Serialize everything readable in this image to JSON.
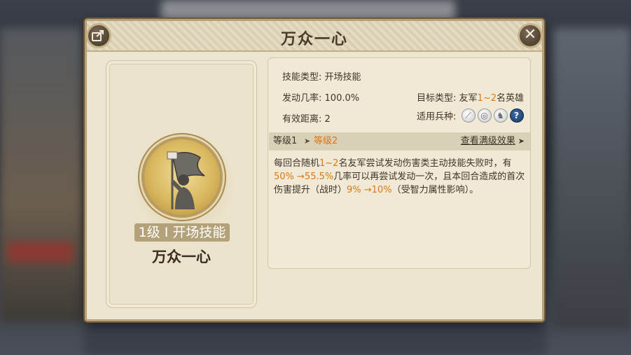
{
  "panel": {
    "title": "万众一心"
  },
  "left": {
    "level_num": "1级",
    "level_sep": " I ",
    "level_type": "开场技能",
    "skill_name": "万众一心"
  },
  "info": {
    "skill_type_label": "技能类型:",
    "skill_type_value": "开场技能",
    "trigger_label": "发动几率:",
    "trigger_value": "100.0%",
    "target_label": "目标类型:",
    "target_prefix": "友军",
    "target_range": "1~2",
    "target_suffix": "名英雄",
    "range_label": "有效距离:",
    "range_value": "2",
    "troops_label": "适用兵种:",
    "troop_icons": [
      "sword-icon",
      "shield-ring-icon",
      "horse-icon",
      "question-icon"
    ]
  },
  "levels": {
    "level1": "等级1",
    "arrow": "➤",
    "level2": "等级2",
    "full_effect": "查看满级效果",
    "chevron": "➤"
  },
  "description": {
    "p1": "每回合随机",
    "n1": "1~2",
    "p2": "名友军尝试发动伤害类主动技能失败时，有",
    "n2": "50% →55.5%",
    "p3": "几率可以再尝试发动一次，且本回合造成的首次伤害提升（战时）",
    "n3": "9% →10%",
    "p4": "（受智力属性影响）。"
  },
  "colors": {
    "accent_orange": "#d97a1a",
    "panel_bg": "#ece5cf",
    "frame": "#b9a27a"
  }
}
